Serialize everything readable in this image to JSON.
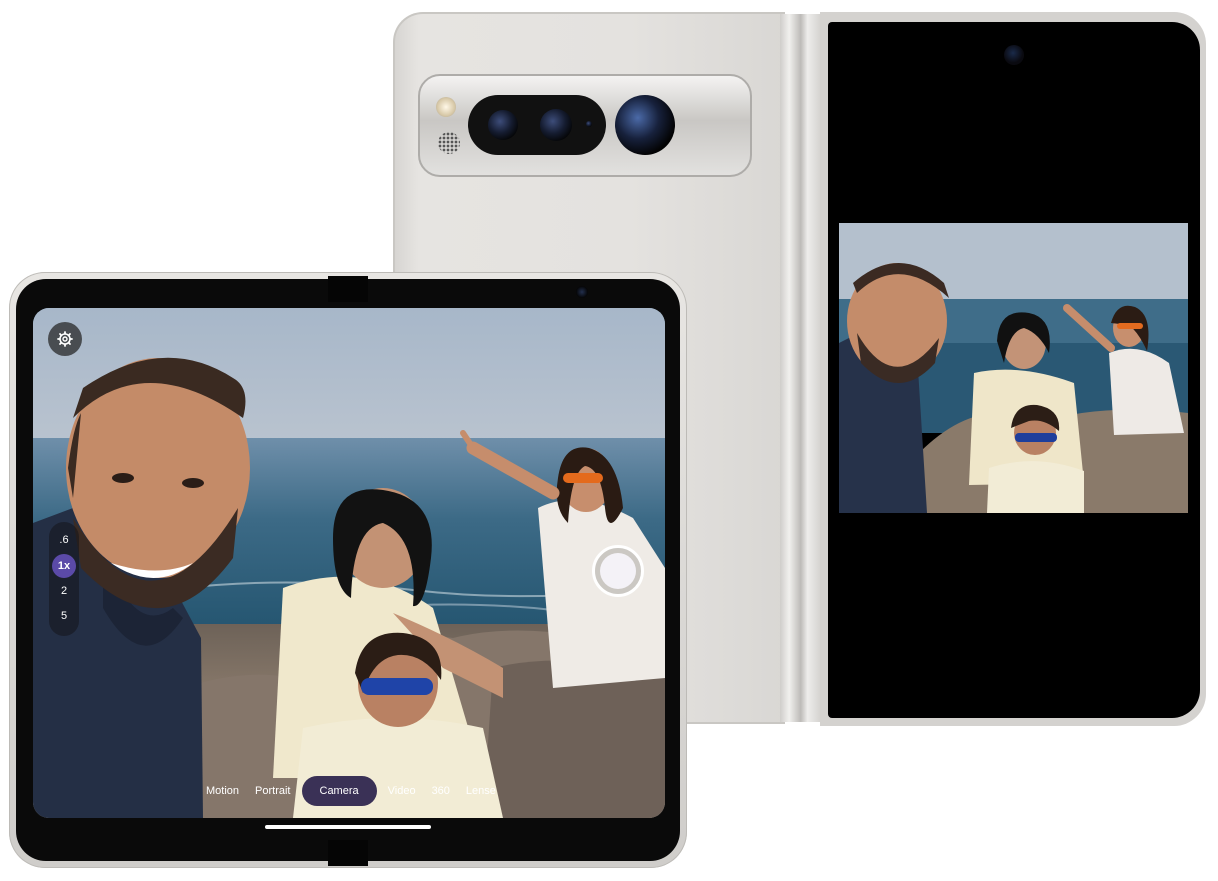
{
  "camera_app": {
    "zoom_levels": [
      ".6",
      "1x",
      "2",
      "5"
    ],
    "active_zoom": "1x",
    "modes": [
      "Motion",
      "Portrait",
      "Camera",
      "Video",
      "360",
      "Lense"
    ],
    "active_mode": "Camera"
  },
  "icons": {
    "settings": "gear-icon",
    "shutter": "shutter-button"
  },
  "colors": {
    "accent": "#5b4aa8",
    "active_mode_bg": "#3a3156",
    "device_finish": "#e4e2df"
  }
}
